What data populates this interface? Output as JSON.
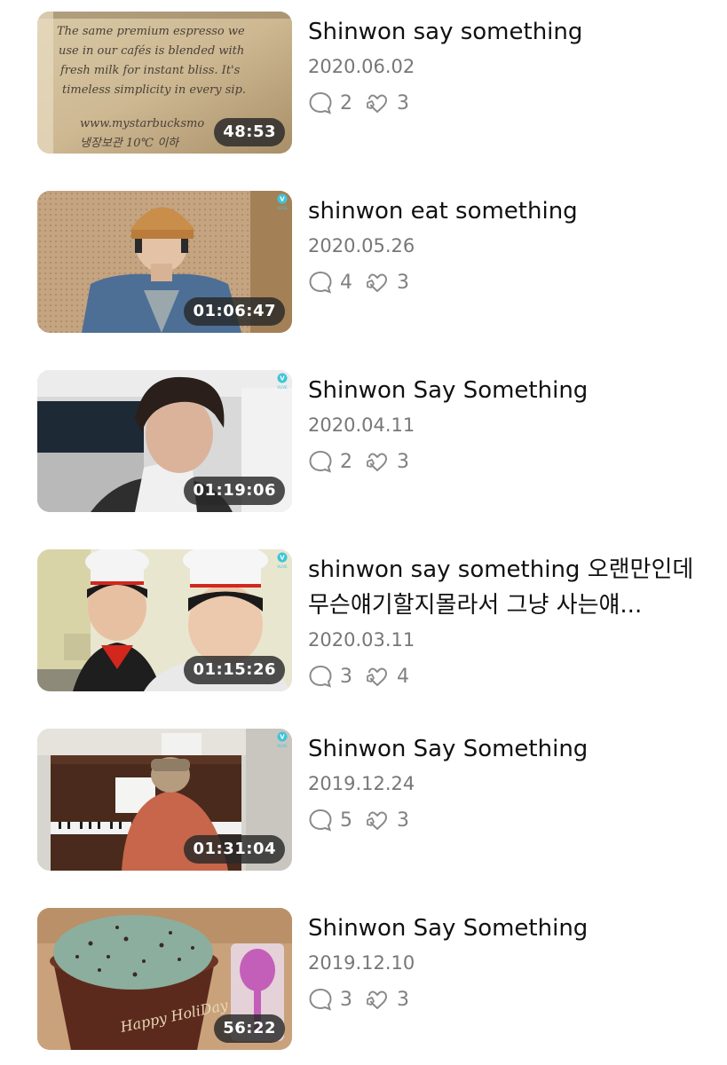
{
  "videos": [
    {
      "title": "Shinwon say something",
      "date": "2020.06.02",
      "comments": "2",
      "likes": "3",
      "duration": "48:53",
      "thumb_text": "The same premium espresso we use in our cafés is blended with fresh milk for instant bliss. It's timeless simplicity in every sip.",
      "thumb_url": "www.mystarbucksmo",
      "thumb_korean": "냉장보관 10℃ 이하"
    },
    {
      "title": "shinwon eat something",
      "date": "2020.05.26",
      "comments": "4",
      "likes": "3",
      "duration": "01:06:47"
    },
    {
      "title": "Shinwon Say Something",
      "date": "2020.04.11",
      "comments": "2",
      "likes": "3",
      "duration": "01:19:06"
    },
    {
      "title": "shinwon say something 오랜만인데 무슨얘기할지몰라서 그냥 사는얘...",
      "date": "2020.03.11",
      "comments": "3",
      "likes": "4",
      "duration": "01:15:26"
    },
    {
      "title": "Shinwon Say Something",
      "date": "2019.12.24",
      "comments": "5",
      "likes": "3",
      "duration": "01:31:04"
    },
    {
      "title": "Shinwon Say Something",
      "date": "2019.12.10",
      "comments": "3",
      "likes": "3",
      "duration": "56:22",
      "thumb_text": "Happy HoliDay"
    }
  ],
  "icons": {
    "comment": "comment-bubble-icon",
    "like": "heart-hand-icon",
    "vlive": "vlive-logo-icon"
  },
  "colors": {
    "title": "#111111",
    "meta": "#777777",
    "duration_bg": "#282828",
    "vlive": "#3ec5d8"
  }
}
